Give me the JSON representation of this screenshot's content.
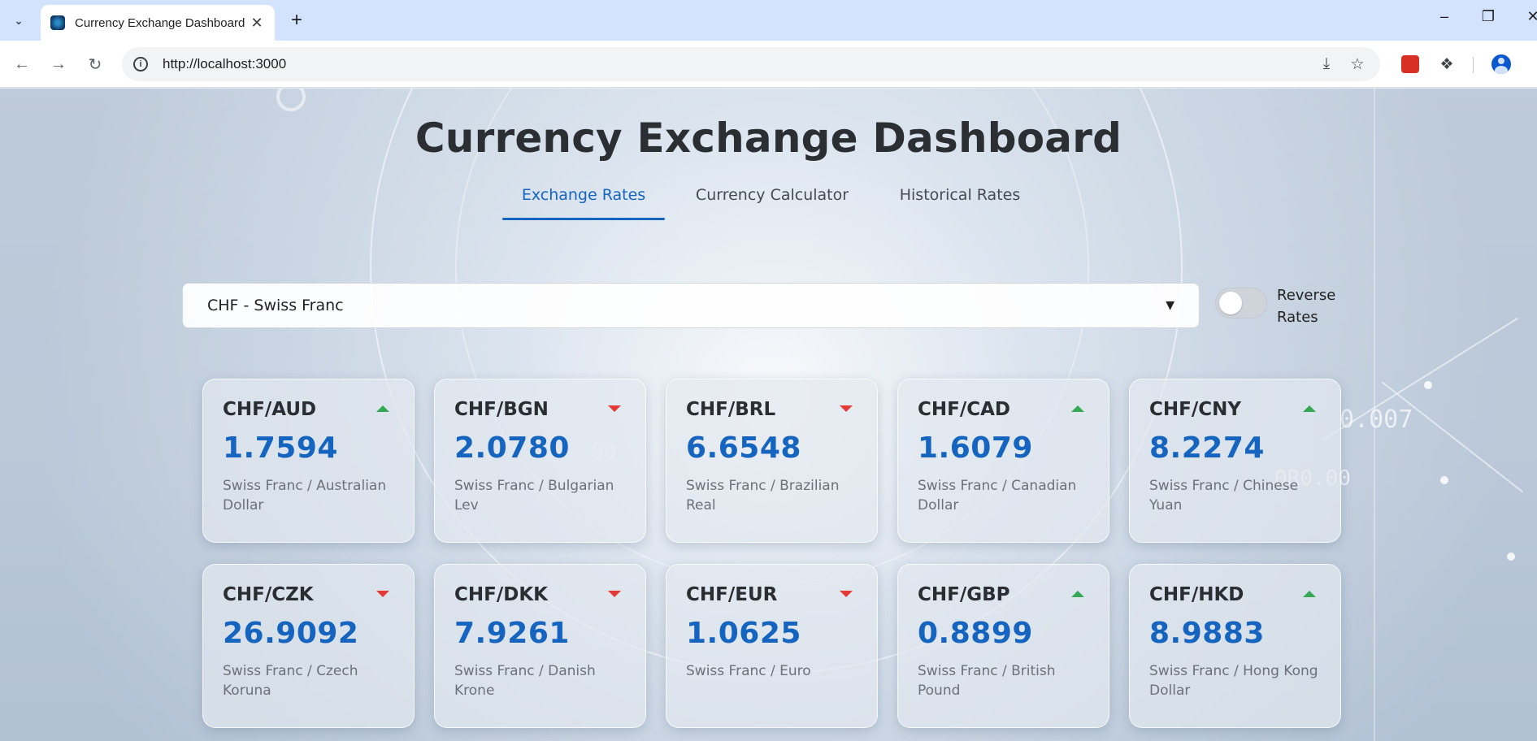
{
  "browser": {
    "tab_title": "Currency Exchange Dashboard",
    "url": "http://localhost:3000",
    "icons": {
      "tab_menu": "chevron-down-icon",
      "close_tab": "close-icon",
      "new_tab": "plus-icon",
      "back": "arrow-left-icon",
      "forward": "arrow-right-icon",
      "reload": "reload-icon",
      "site_info": "info-icon",
      "install": "install-icon",
      "bookmark": "star-icon",
      "extension": "extension-icon",
      "extensions_menu": "puzzle-icon",
      "profile": "profile-icon"
    }
  },
  "page": {
    "title": "Currency Exchange Dashboard",
    "tabs": [
      {
        "label": "Exchange Rates",
        "active": true
      },
      {
        "label": "Currency Calculator",
        "active": false
      },
      {
        "label": "Historical Rates",
        "active": false
      }
    ],
    "base_currency": {
      "selected": "CHF - Swiss Franc"
    },
    "reverse_toggle": {
      "label": "Reverse Rates",
      "on": false
    },
    "accent_color": "#1565c0",
    "trend_colors": {
      "up": "#34a853",
      "down": "#e53935"
    },
    "rates": [
      {
        "pair": "CHF/AUD",
        "rate": "1.7594",
        "name": "Swiss Franc / Australian Dollar",
        "trend": "up"
      },
      {
        "pair": "CHF/BGN",
        "rate": "2.0780",
        "name": "Swiss Franc / Bulgarian Lev",
        "trend": "down"
      },
      {
        "pair": "CHF/BRL",
        "rate": "6.6548",
        "name": "Swiss Franc / Brazilian Real",
        "trend": "down"
      },
      {
        "pair": "CHF/CAD",
        "rate": "1.6079",
        "name": "Swiss Franc / Canadian Dollar",
        "trend": "up"
      },
      {
        "pair": "CHF/CNY",
        "rate": "8.2274",
        "name": "Swiss Franc / Chinese Yuan",
        "trend": "up"
      },
      {
        "pair": "CHF/CZK",
        "rate": "26.9092",
        "name": "Swiss Franc / Czech Koruna",
        "trend": "down"
      },
      {
        "pair": "CHF/DKK",
        "rate": "7.9261",
        "name": "Swiss Franc / Danish Krone",
        "trend": "down"
      },
      {
        "pair": "CHF/EUR",
        "rate": "1.0625",
        "name": "Swiss Franc / Euro",
        "trend": "down"
      },
      {
        "pair": "CHF/GBP",
        "rate": "0.8899",
        "name": "Swiss Franc / British Pound",
        "trend": "up"
      },
      {
        "pair": "CHF/HKD",
        "rate": "8.9883",
        "name": "Swiss Franc / Hong Kong Dollar",
        "trend": "up"
      }
    ]
  }
}
